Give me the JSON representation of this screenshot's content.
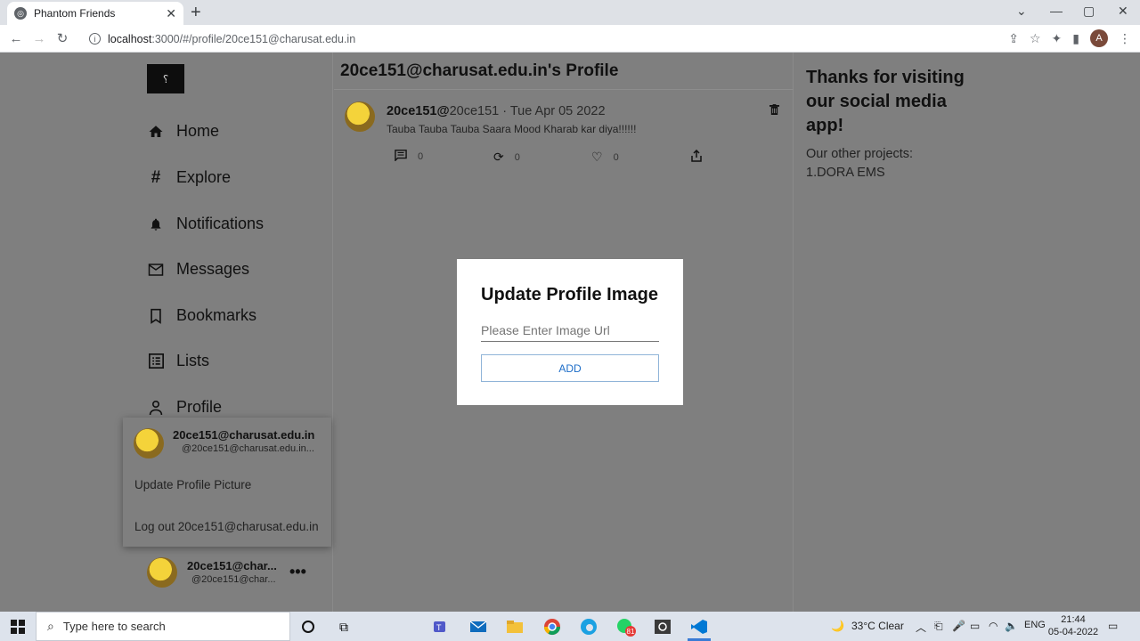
{
  "browser": {
    "tab_title": "Phantom Friends",
    "url_host": "localhost",
    "url_path": ":3000/#/profile/20ce151@charusat.edu.in",
    "profile_initial": "A"
  },
  "sidebar": {
    "items": [
      {
        "label": "Home",
        "icon": "home-icon"
      },
      {
        "label": "Explore",
        "icon": "hash-icon"
      },
      {
        "label": "Notifications",
        "icon": "bell-icon"
      },
      {
        "label": "Messages",
        "icon": "mail-icon"
      },
      {
        "label": "Bookmarks",
        "icon": "bookmark-icon"
      },
      {
        "label": "Lists",
        "icon": "list-icon"
      },
      {
        "label": "Profile",
        "icon": "person-icon"
      }
    ]
  },
  "account_menu": {
    "name": "20ce151@charusat.edu.in",
    "handle": "@20ce151@charusat.edu.in...",
    "update_picture": "Update Profile Picture",
    "logout": "Log out 20ce151@charusat.edu.in"
  },
  "bottom_user": {
    "name": "20ce151@char...",
    "handle": "@20ce151@char...",
    "more": "•••"
  },
  "main": {
    "header": "20ce151@charusat.edu.in's Profile",
    "post": {
      "author_bold": "20ce151@",
      "author_rest": "20ce151 · Tue Apr 05 2022",
      "text": "Tauba Tauba Tauba Saara Mood Kharab kar diya!!!!!!",
      "comments": "0",
      "retweets": "0",
      "likes": "0"
    }
  },
  "right": {
    "title": "Thanks for visiting our social media app!",
    "line1": "Our other projects:",
    "line2": "1.DORA EMS"
  },
  "modal": {
    "title": "Update Profile Image",
    "placeholder": "Please Enter Image Url",
    "add_label": "ADD"
  },
  "taskbar": {
    "search_placeholder": "Type here to search",
    "weather": "33°C  Clear",
    "lang": "ENG",
    "time": "21:44",
    "date": "05-04-2022",
    "whatsapp_badge": "81"
  }
}
